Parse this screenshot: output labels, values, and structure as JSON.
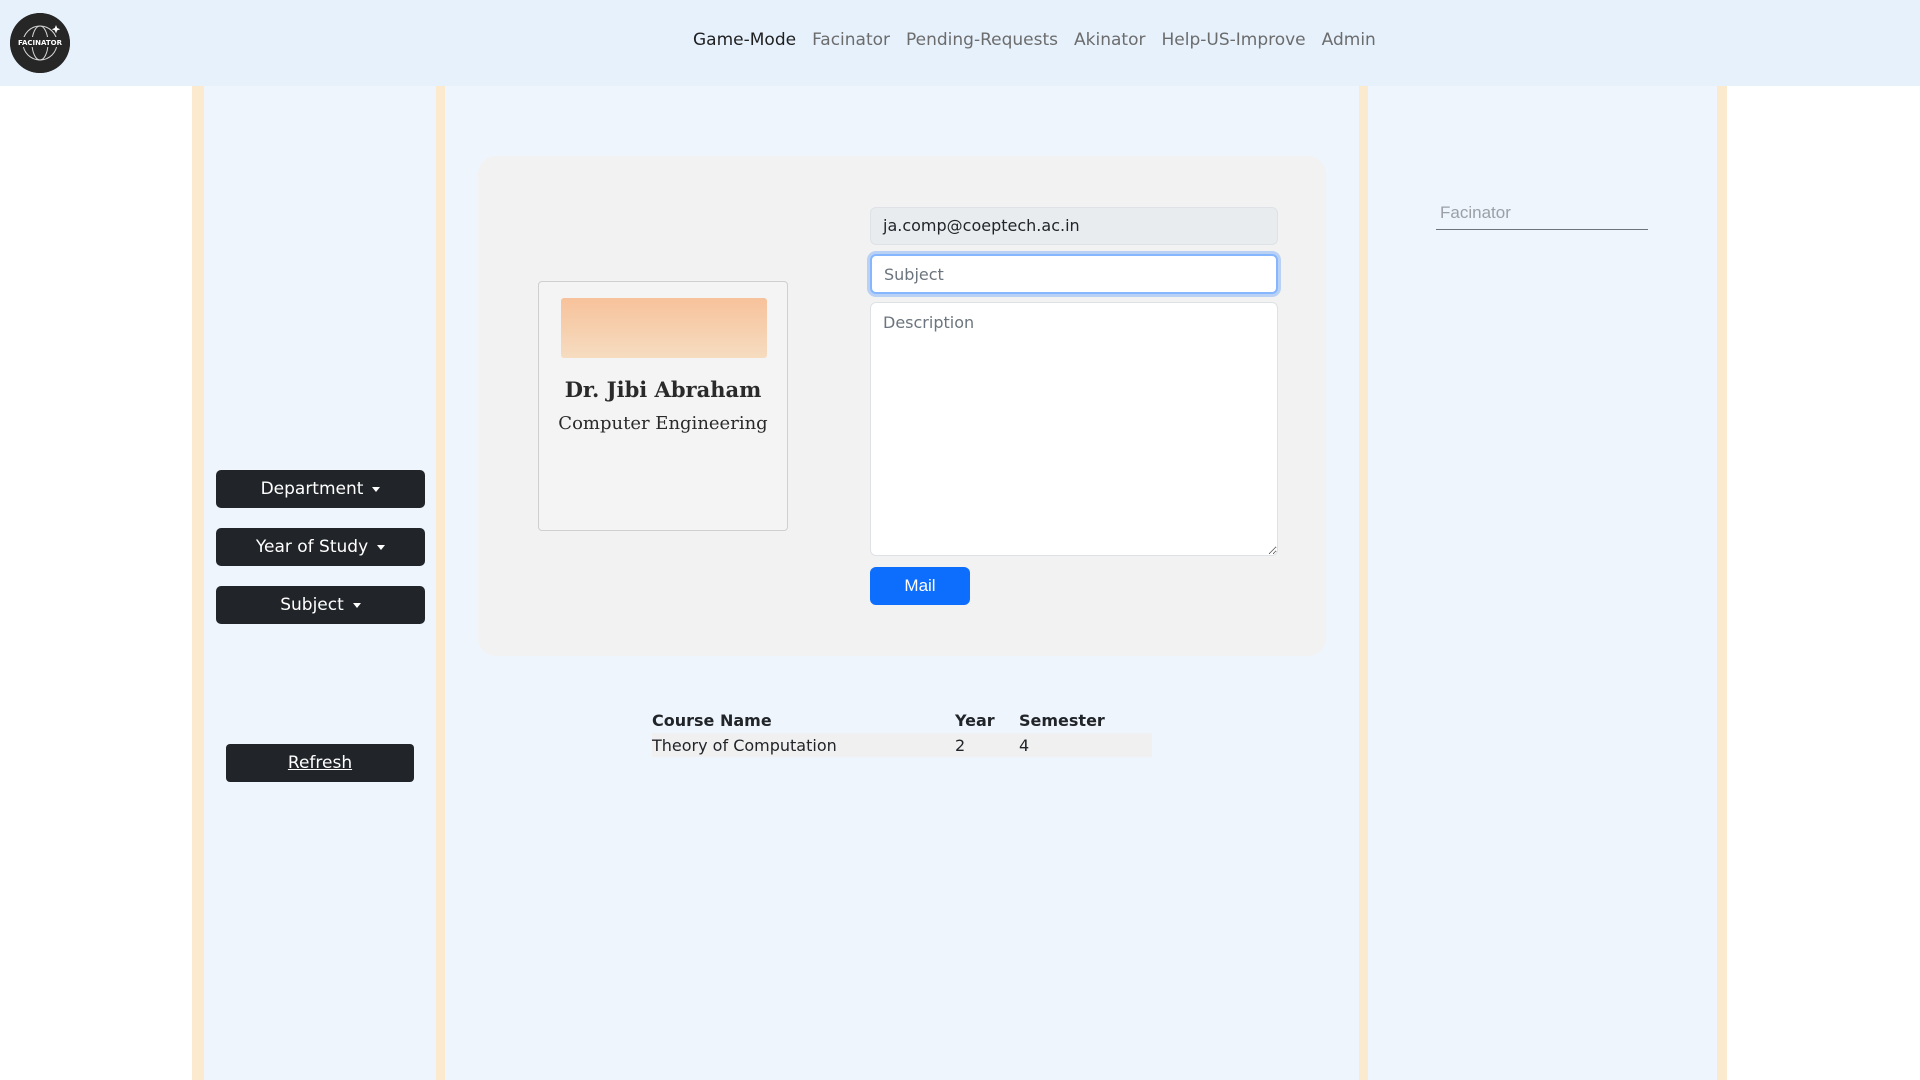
{
  "app": {
    "logo_text": "FACINATOR"
  },
  "navbar": {
    "items": [
      {
        "label": "Game-Mode"
      },
      {
        "label": "Facinator"
      },
      {
        "label": "Pending-Requests"
      },
      {
        "label": "Akinator"
      },
      {
        "label": "Help-US-Improve"
      },
      {
        "label": "Admin"
      }
    ],
    "active": "Game-Mode"
  },
  "filters": {
    "department_label": "Department",
    "year_label": "Year of Study",
    "subject_label": "Subject",
    "refresh_label": "Refresh"
  },
  "profile": {
    "name": "Dr. Jibi Abraham",
    "department": "Computer Engineering"
  },
  "mail_form": {
    "email_value": "ja.comp@coeptech.ac.in",
    "subject_placeholder": "Subject",
    "description_placeholder": "Description",
    "mail_label": "Mail"
  },
  "courses": {
    "headers": [
      "Course Name",
      "Year",
      "Semester"
    ],
    "rows": [
      {
        "course": "Theory of Computation",
        "year": "2",
        "semester": "4"
      }
    ]
  },
  "search": {
    "placeholder": "Facinator"
  },
  "colors": {
    "navbar_bg": "#e6f1fc",
    "panel_bg": "#eef5fd",
    "stripe": "#fbeacd",
    "dark_button": "#212529",
    "primary_button": "#0d6efd"
  }
}
